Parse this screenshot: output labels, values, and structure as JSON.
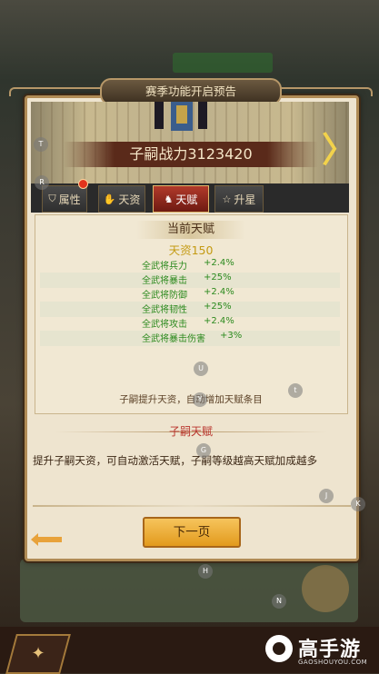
{
  "window_title": "赛季功能开启预告",
  "hero": {
    "power_label": "子嗣战力3123420"
  },
  "tabs": [
    {
      "label": "属性",
      "icon": "shield-icon",
      "active": false
    },
    {
      "label": "天资",
      "icon": "hand-icon",
      "active": false
    },
    {
      "label": "天赋",
      "icon": "horse-icon",
      "active": true
    },
    {
      "label": "升星",
      "icon": "star-icon",
      "active": false
    }
  ],
  "current_talent": {
    "title": "当前天赋",
    "aptitude": "天资150",
    "rows": [
      {
        "name": "全武将兵力",
        "value": "+2.4%"
      },
      {
        "name": "全武将暴击",
        "value": "+25%"
      },
      {
        "name": "全武将防御",
        "value": "+2.4%"
      },
      {
        "name": "全武将韧性",
        "value": "+25%"
      },
      {
        "name": "全武将攻击",
        "value": "+2.4%"
      },
      {
        "name": "全武将暴击伤害",
        "value": "+3%"
      }
    ],
    "hint": "子嗣提升天资，自动增加天赋条目"
  },
  "section": {
    "title": "子嗣天赋",
    "description": "提升子嗣天资，可自动激活天赋，子嗣等级越高天赋加成越多"
  },
  "buttons": {
    "next_page": "下一页"
  },
  "key_markers": [
    "T",
    "R",
    "U",
    "Y",
    "t",
    "G",
    "J",
    "K",
    "H",
    "N"
  ],
  "watermark": {
    "main": "高手游",
    "sub": "GAOSHOUYOU.COM"
  },
  "colors": {
    "accent_gold": "#e29a1d",
    "talent_green": "#2c8a1e",
    "active_tab_red": "#b13a2a"
  }
}
